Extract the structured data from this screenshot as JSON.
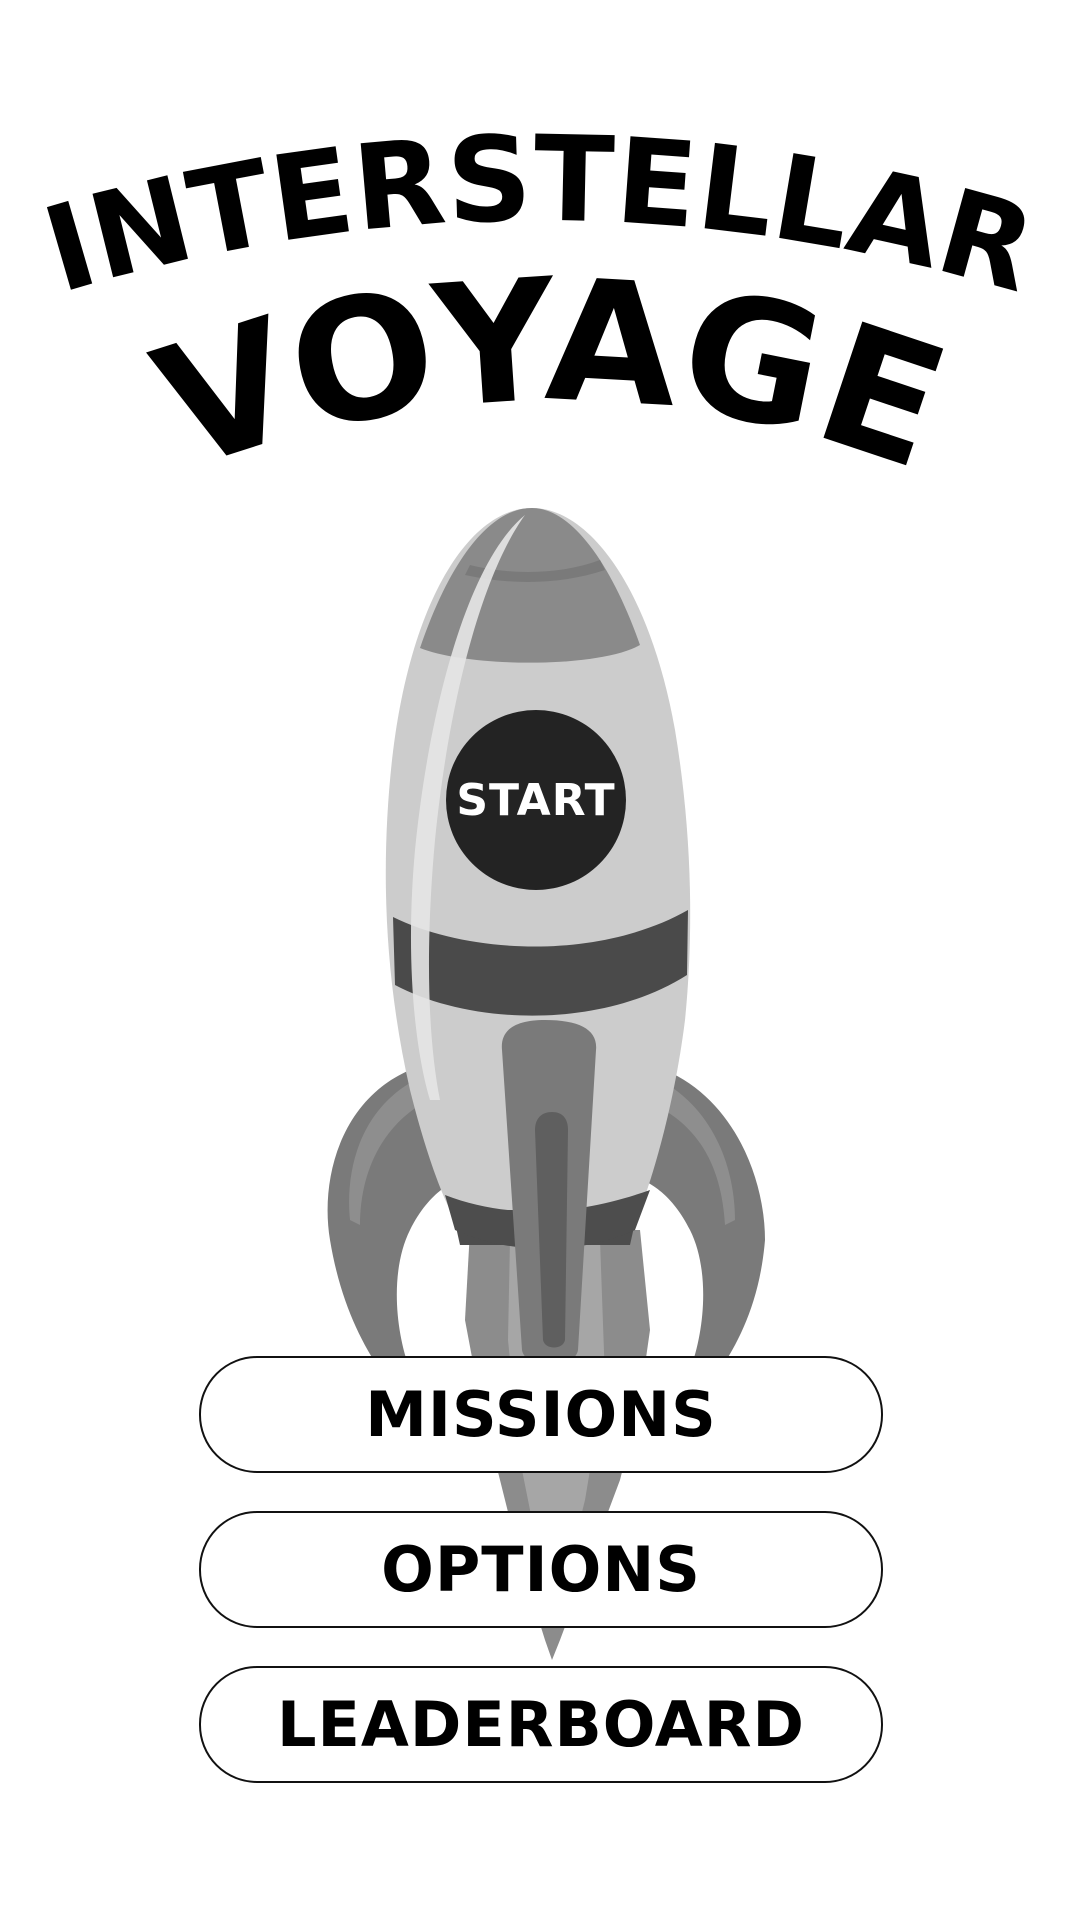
{
  "title": {
    "line1": "INTERSTELLAR",
    "line2": "VOYAGE"
  },
  "rocket": {
    "illustration": "rocket-icon",
    "window_button_label": "START"
  },
  "menu": {
    "items": [
      {
        "label": "MISSIONS"
      },
      {
        "label": "OPTIONS"
      },
      {
        "label": "LEADERBOARD"
      }
    ]
  },
  "colors": {
    "background": "#ffffff",
    "title": "#000000",
    "start_button": "#232323",
    "button_border": "#111111"
  }
}
